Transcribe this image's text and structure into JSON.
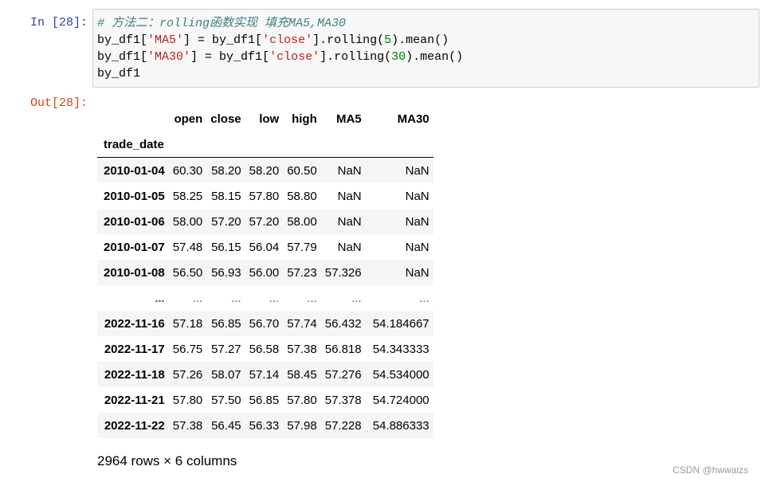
{
  "cell": {
    "in_prompt": "In  [28]:",
    "out_prompt": "Out[28]:",
    "code": {
      "comment": "# 方法二：rolling函数实现 填充MA5,MA30",
      "l2_a": "by_df1[",
      "l2_s1": "'MA5'",
      "l2_b": "] = by_df1[",
      "l2_s2": "'close'",
      "l2_c": "].rolling(",
      "l2_n": "5",
      "l2_d": ").mean()",
      "l3_a": "by_df1[",
      "l3_s1": "'MA30'",
      "l3_b": "] = by_df1[",
      "l3_s2": "'close'",
      "l3_c": "].rolling(",
      "l3_n": "30",
      "l3_d": ").mean()",
      "l4": "by_df1"
    }
  },
  "dataframe": {
    "columns": [
      "open",
      "close",
      "low",
      "high",
      "MA5",
      "MA30"
    ],
    "index_name": "trade_date",
    "rows": [
      {
        "idx": "2010-01-04",
        "v": [
          "60.30",
          "58.20",
          "58.20",
          "60.50",
          "NaN",
          "NaN"
        ]
      },
      {
        "idx": "2010-01-05",
        "v": [
          "58.25",
          "58.15",
          "57.80",
          "58.80",
          "NaN",
          "NaN"
        ]
      },
      {
        "idx": "2010-01-06",
        "v": [
          "58.00",
          "57.20",
          "57.20",
          "58.00",
          "NaN",
          "NaN"
        ]
      },
      {
        "idx": "2010-01-07",
        "v": [
          "57.48",
          "56.15",
          "56.04",
          "57.79",
          "NaN",
          "NaN"
        ]
      },
      {
        "idx": "2010-01-08",
        "v": [
          "56.50",
          "56.93",
          "56.00",
          "57.23",
          "57.326",
          "NaN"
        ]
      },
      {
        "idx": "...",
        "v": [
          "...",
          "...",
          "...",
          "...",
          "...",
          "..."
        ]
      },
      {
        "idx": "2022-11-16",
        "v": [
          "57.18",
          "56.85",
          "56.70",
          "57.74",
          "56.432",
          "54.184667"
        ]
      },
      {
        "idx": "2022-11-17",
        "v": [
          "56.75",
          "57.27",
          "56.58",
          "57.38",
          "56.818",
          "54.343333"
        ]
      },
      {
        "idx": "2022-11-18",
        "v": [
          "57.26",
          "58.07",
          "57.14",
          "58.45",
          "57.276",
          "54.534000"
        ]
      },
      {
        "idx": "2022-11-21",
        "v": [
          "57.80",
          "57.50",
          "56.85",
          "57.80",
          "57.378",
          "54.724000"
        ]
      },
      {
        "idx": "2022-11-22",
        "v": [
          "57.38",
          "56.45",
          "56.33",
          "57.98",
          "57.228",
          "54.886333"
        ]
      }
    ],
    "shape_text": "2964 rows × 6 columns"
  },
  "watermark": "CSDN @hwwaizs"
}
